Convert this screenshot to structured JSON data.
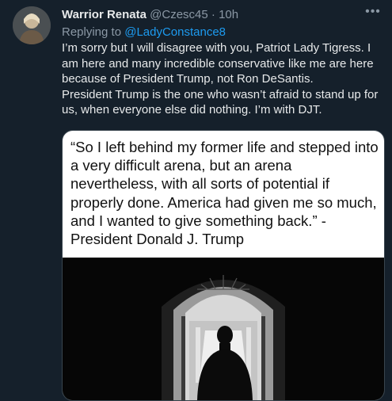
{
  "tweet": {
    "display_name": "Warrior Renata",
    "handle": "@Czesc45",
    "separator": "·",
    "time": "10h",
    "more_icon": "more-horizontal-icon",
    "replying_prefix": "Replying to",
    "replying_to": "@LadyConstance8",
    "body_lines": [
      "I’m sorry but I will disagree with you, Patriot Lady Tigress. I am here and many incredible conservative like me are here because of President Trump, not Ron DeSantis.",
      "President Trump is the one who wasn’t afraid to stand up for us, when everyone else did nothing. I’m with DJT."
    ],
    "media": {
      "quote_text": "“So I left behind my former life and stepped into a very difficult arena, but an arena nevertheless, with all sorts of potential if properly done. America had given me so much, and I wanted to give something back.” - President Donald J. Trump"
    }
  }
}
